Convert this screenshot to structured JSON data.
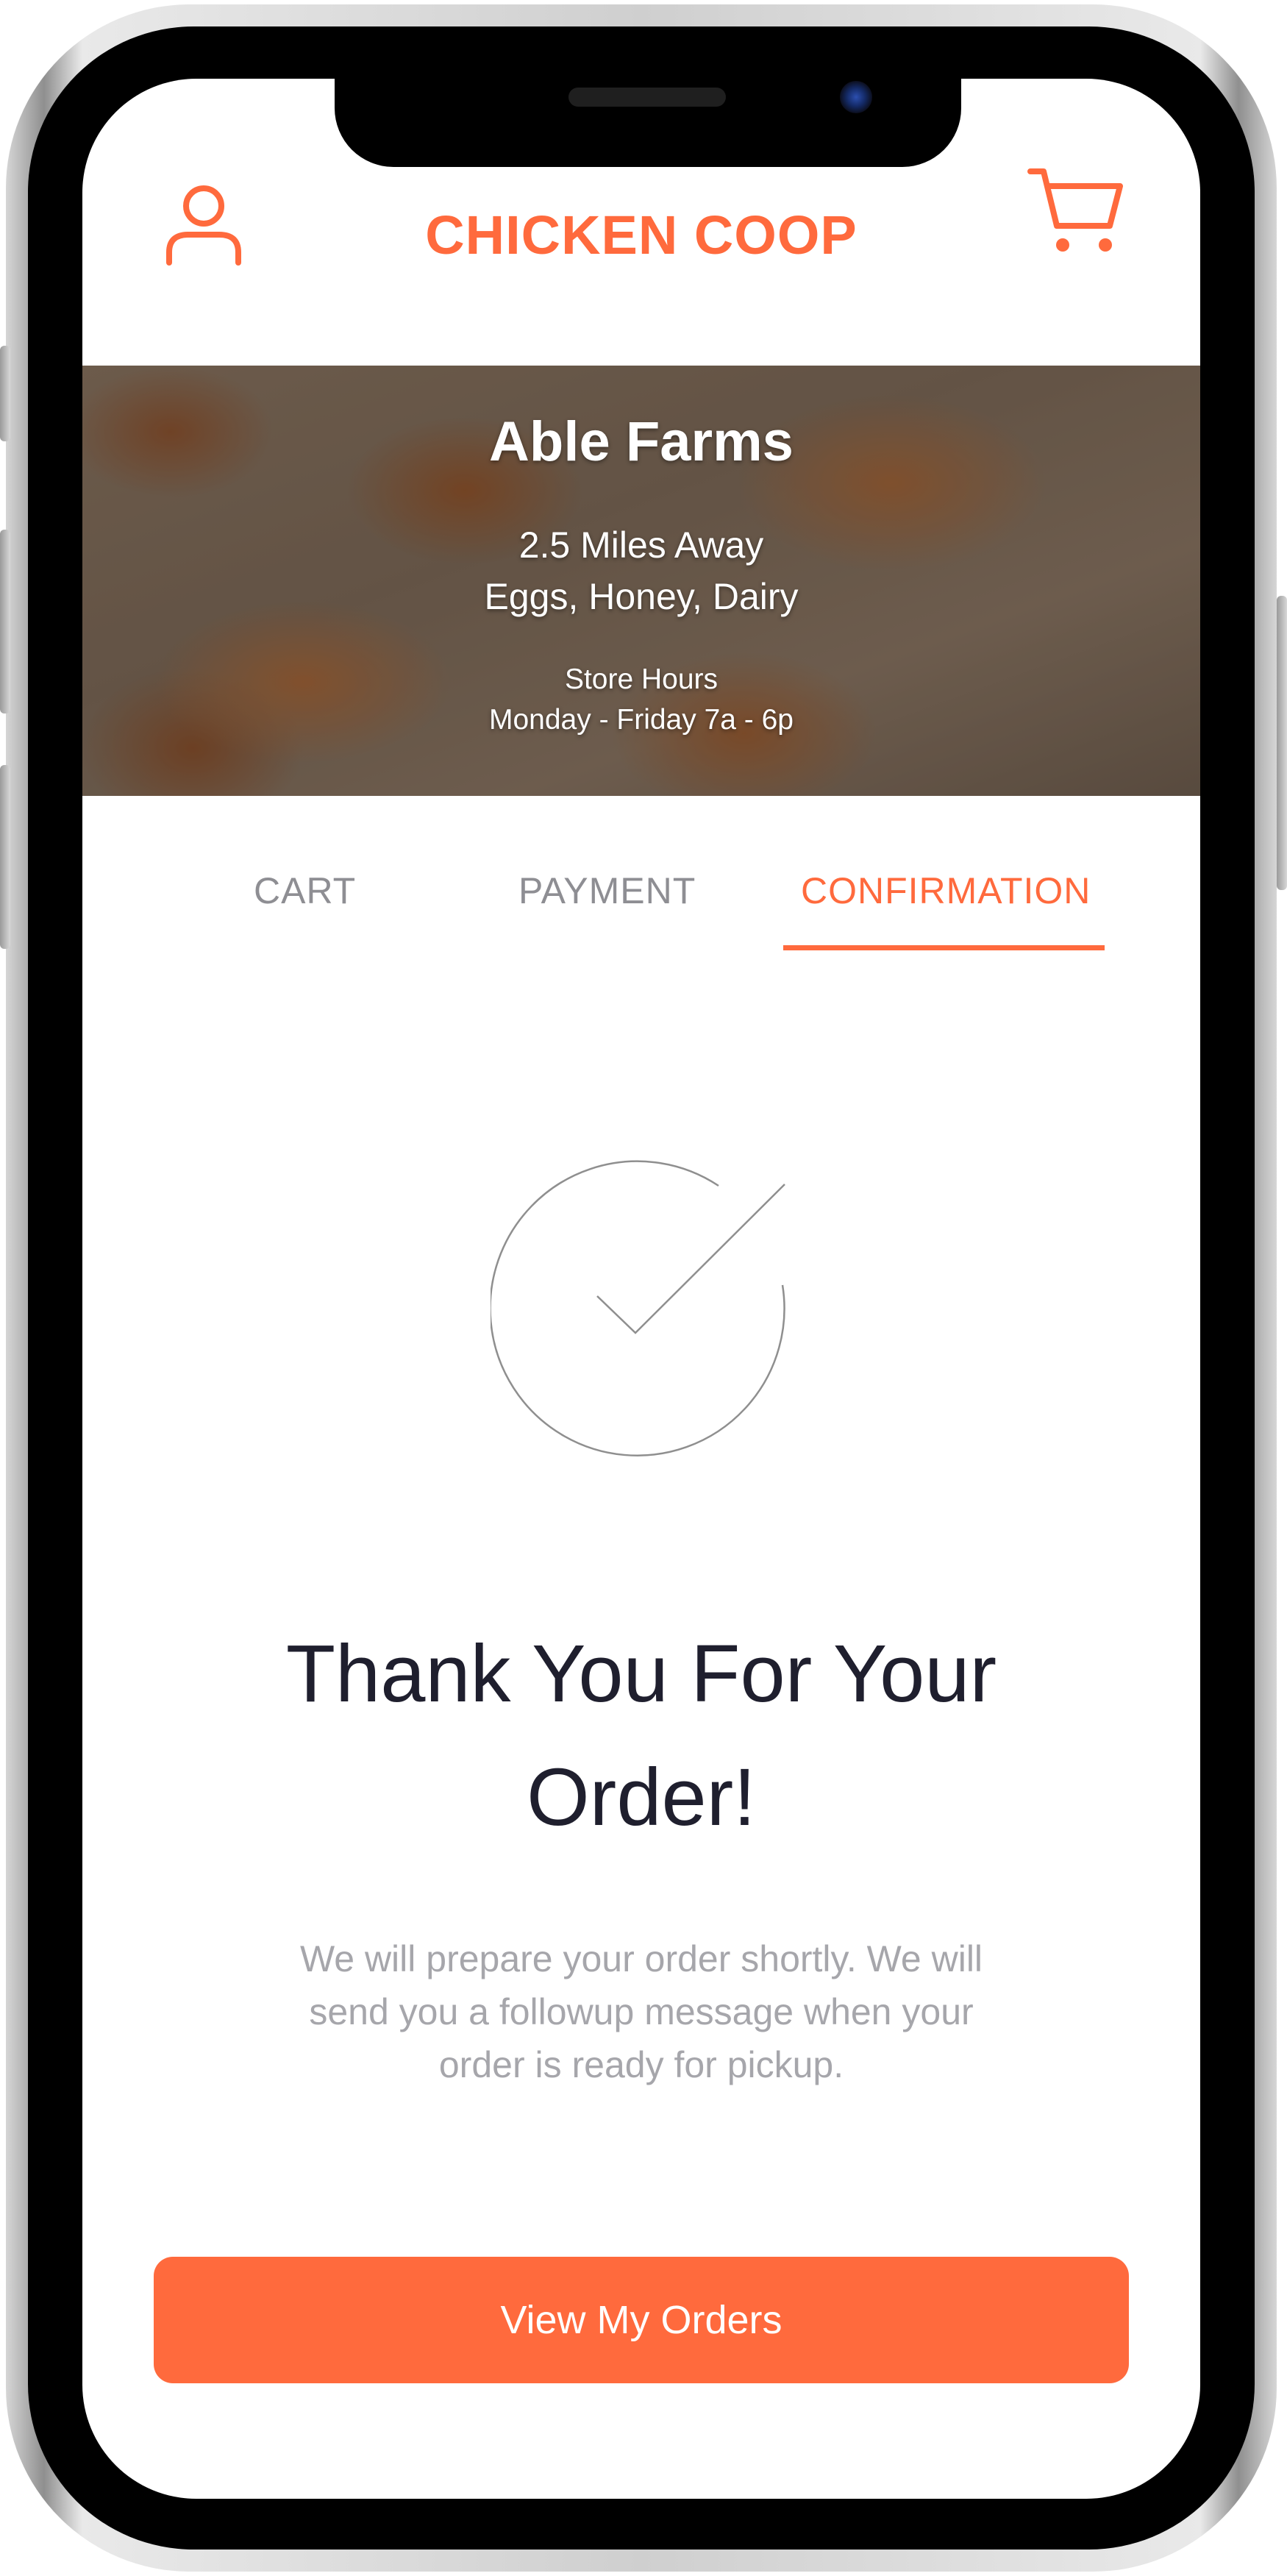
{
  "header": {
    "brand": "CHICKEN COOP",
    "user_icon": "user-icon",
    "cart_icon": "cart-icon",
    "accent_color": "#ff6a3d"
  },
  "store": {
    "name": "Able Farms",
    "distance": "2.5 Miles Away",
    "products": "Eggs, Honey, Dairy",
    "hours_label": "Store Hours",
    "hours": "Monday - Friday 7a - 6p"
  },
  "tabs": [
    {
      "label": "CART",
      "active": false
    },
    {
      "label": "PAYMENT",
      "active": false
    },
    {
      "label": "CONFIRMATION",
      "active": true
    }
  ],
  "confirmation": {
    "icon": "checkmark-circle-icon",
    "title_line1": "Thank You For Your",
    "title_line2": "Order!",
    "message": "We will prepare your order shortly. We will send you a followup message when your order is ready for pickup.",
    "button_label": "View My Orders"
  }
}
